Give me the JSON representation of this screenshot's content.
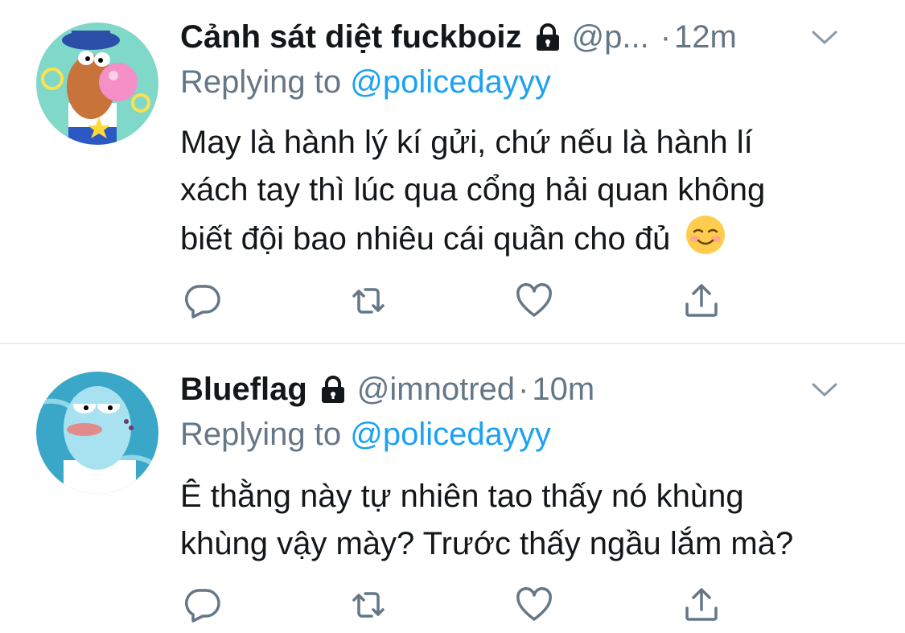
{
  "tweets": [
    {
      "name": "Cảnh sát diệt fuckboiz",
      "handle": "@p...",
      "separator": "·",
      "time": "12m",
      "replying_prefix": "Replying to",
      "replying_to": "@policedayyy",
      "body_lines": [
        "May là hành lý kí gửi, chứ nếu là hành lí",
        "xách tay thì lúc qua cổng hải quan không",
        "biết đội bao nhiêu cái quần cho đủ"
      ],
      "emoji": "smiling-face-emoji"
    },
    {
      "name": "Blueflag",
      "handle": "@imnotred",
      "separator": "·",
      "time": "10m",
      "replying_prefix": "Replying to",
      "replying_to": "@policedayyy",
      "body_lines": [
        "Ê thằng này tự nhiên tao thấy nó khùng",
        "khùng vậy mày? Trước thấy ngầu lắm mà?"
      ]
    }
  ],
  "icons": {
    "lock": "lock-icon",
    "chevron": "chevron-down-icon",
    "reply": "reply-icon",
    "retweet": "retweet-icon",
    "like": "like-icon",
    "share": "share-icon"
  },
  "colors": {
    "text": "#14171a",
    "secondary": "#657786",
    "link": "#1da1f2",
    "divider": "#e6ecf0",
    "icon": "#657786"
  }
}
